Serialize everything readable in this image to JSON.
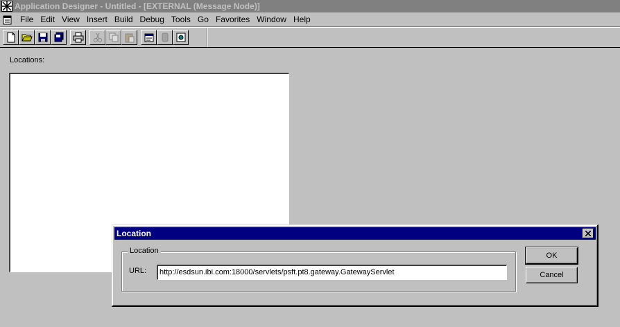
{
  "window": {
    "title": "Application Designer - Untitled - [EXTERNAL (Message Node)]",
    "icon": "app-designer-icon"
  },
  "menubar": {
    "items": [
      "File",
      "Edit",
      "View",
      "Insert",
      "Build",
      "Debug",
      "Tools",
      "Go",
      "Favorites",
      "Window",
      "Help"
    ]
  },
  "toolbar": {
    "buttons": [
      {
        "icon": "new-document-icon",
        "enabled": true
      },
      {
        "icon": "open-folder-icon",
        "enabled": true
      },
      {
        "icon": "save-icon",
        "enabled": true
      },
      {
        "icon": "save-all-icon",
        "enabled": true
      },
      {
        "icon": "print-icon",
        "enabled": true
      },
      {
        "icon": "cut-icon",
        "enabled": false
      },
      {
        "icon": "copy-icon",
        "enabled": false
      },
      {
        "icon": "paste-icon",
        "enabled": false
      },
      {
        "icon": "properties-icon",
        "enabled": true
      },
      {
        "icon": "project-icon",
        "enabled": false
      },
      {
        "icon": "build-icon",
        "enabled": true
      }
    ]
  },
  "main": {
    "locations_label": "Locations:"
  },
  "dialog": {
    "title": "Location",
    "group_label": "Location",
    "url_label": "URL:",
    "url_value": "http://esdsun.ibi.com:18000/servlets/psft.pt8.gateway.GatewayServlet",
    "ok_label": "OK",
    "cancel_label": "Cancel"
  }
}
